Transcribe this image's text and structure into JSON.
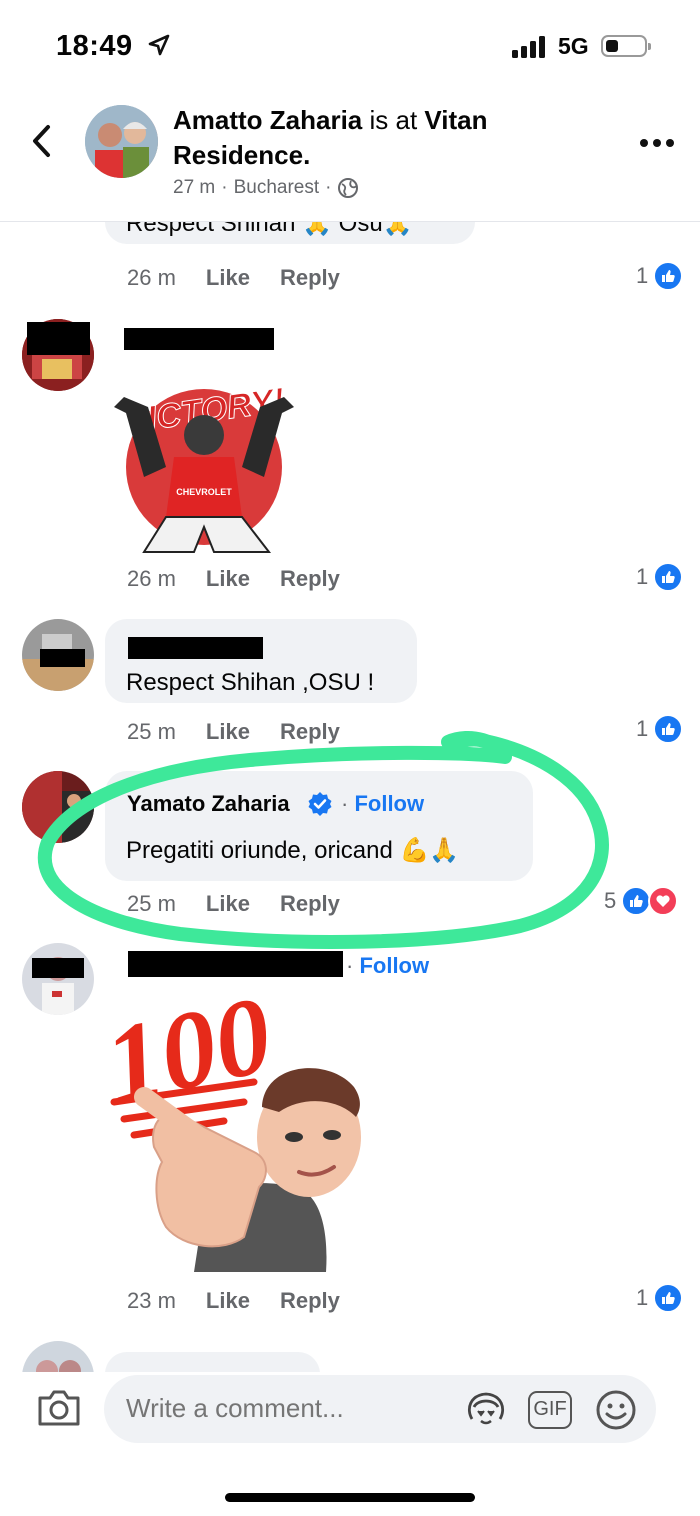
{
  "status": {
    "time": "18:49",
    "network": "5G"
  },
  "header": {
    "name": "Amatto Zaharia",
    "is_at": " is at ",
    "place": "Vitan Residence.",
    "time_ago": "27 m",
    "sep": "·",
    "location": "Bucharest"
  },
  "comments": [
    {
      "text": "Respect Shihan 🙏 Osu🙏",
      "time": "26 m",
      "like": "Like",
      "reply": "Reply",
      "reactions": "1"
    },
    {
      "sticker_text": "VICTORY!",
      "sticker_logo": "CHEVROLET",
      "time": "26 m",
      "like": "Like",
      "reply": "Reply",
      "reactions": "1"
    },
    {
      "text": "Respect Shihan ,OSU !",
      "time": "25 m",
      "like": "Like",
      "reply": "Reply",
      "reactions": "1"
    },
    {
      "name": "Yamato Zaharia",
      "follow": "Follow",
      "text": "Pregatiti oriunde, oricand 💪🙏",
      "time": "25 m",
      "like": "Like",
      "reply": "Reply",
      "reactions": "5"
    },
    {
      "follow": "Follow",
      "sticker_text": "100",
      "time": "23 m",
      "like": "Like",
      "reply": "Reply",
      "reactions": "1"
    }
  ],
  "composer": {
    "placeholder": "Write a comment...",
    "gif": "GIF"
  },
  "colors": {
    "accent": "#1877f2",
    "highlight": "#3ee89a",
    "heart": "#f33e58"
  }
}
